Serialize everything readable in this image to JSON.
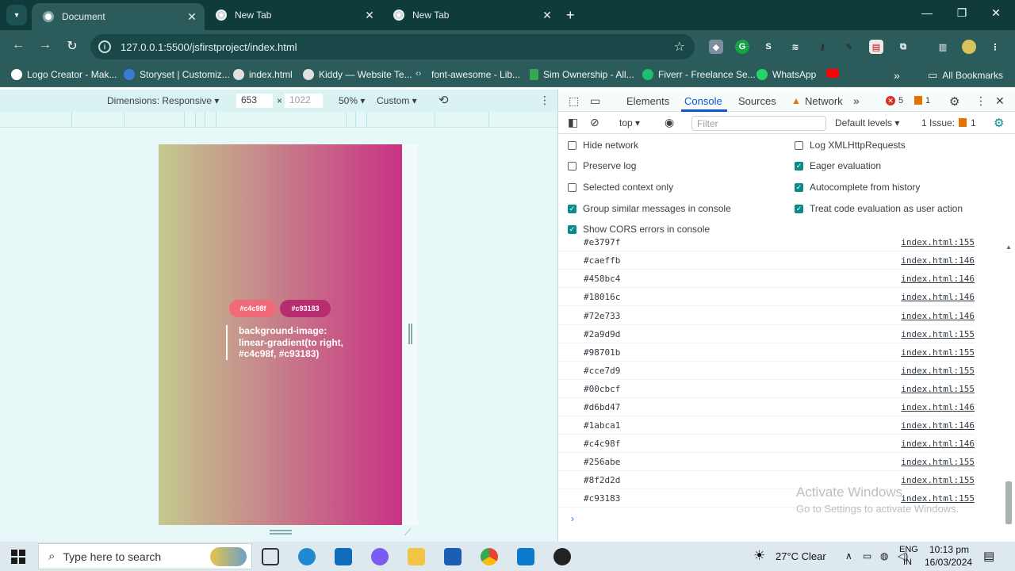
{
  "browser": {
    "tabs": [
      {
        "label": "Document"
      },
      {
        "label": "New Tab"
      },
      {
        "label": "New Tab"
      }
    ],
    "url": "127.0.0.1:5500/jsfirstproject/index.html",
    "bookmarks": [
      {
        "label": "Logo Creator - Mak...",
        "color": "#ffffff"
      },
      {
        "label": "Storyset | Customiz...",
        "color": "#3a7bd5"
      },
      {
        "label": "index.html",
        "color": "#e0e0e0"
      },
      {
        "label": "Kiddy — Website Te...",
        "color": "#e0e0e0"
      },
      {
        "label": "font-awesome - Lib...",
        "color": "#e0e0e0"
      },
      {
        "label": "Sim Ownership - All...",
        "color": "#34a853"
      },
      {
        "label": "Fiverr - Freelance Se...",
        "color": "#1dbf73"
      },
      {
        "label": "WhatsApp",
        "color": "#25d366"
      }
    ],
    "all_bookmarks": "All Bookmarks"
  },
  "device_toolbar": {
    "dimensions": "Dimensions: Responsive",
    "width": "653",
    "times": "×",
    "height": "1022",
    "zoom": "50%",
    "throttle": "Custom"
  },
  "page": {
    "chip1": "#c4c98f",
    "chip2": "#c93183",
    "code": "background-image: linear-gradient(to right, #c4c98f, #c93183)"
  },
  "devtools": {
    "tabs": [
      "Elements",
      "Console",
      "Sources",
      "Network"
    ],
    "errors": "5",
    "warnings": "1",
    "context": "top",
    "filter_placeholder": "Filter",
    "levels": "Default levels",
    "issues": "1 Issue:",
    "issues_count": "1",
    "settings_left": [
      {
        "label": "Hide network",
        "checked": false
      },
      {
        "label": "Preserve log",
        "checked": false
      },
      {
        "label": "Selected context only",
        "checked": false
      },
      {
        "label": "Group similar messages in console",
        "checked": true
      },
      {
        "label": "Show CORS errors in console",
        "checked": true
      }
    ],
    "settings_right": [
      {
        "label": "Log XMLHttpRequests",
        "checked": false
      },
      {
        "label": "Eager evaluation",
        "checked": true
      },
      {
        "label": "Autocomplete from history",
        "checked": true
      },
      {
        "label": "Treat code evaluation as user action",
        "checked": true
      }
    ],
    "logs": [
      {
        "msg": "#e3797f",
        "src": "index.html:155"
      },
      {
        "msg": "#caeffb",
        "src": "index.html:146"
      },
      {
        "msg": "#458bc4",
        "src": "index.html:146"
      },
      {
        "msg": "#18016c",
        "src": "index.html:146"
      },
      {
        "msg": "#72e733",
        "src": "index.html:146"
      },
      {
        "msg": "#2a9d9d",
        "src": "index.html:155"
      },
      {
        "msg": "#98701b",
        "src": "index.html:155"
      },
      {
        "msg": "#cce7d9",
        "src": "index.html:155"
      },
      {
        "msg": "#00cbcf",
        "src": "index.html:155"
      },
      {
        "msg": "#d6bd47",
        "src": "index.html:146"
      },
      {
        "msg": "#1abca1",
        "src": "index.html:146"
      },
      {
        "msg": "#c4c98f",
        "src": "index.html:146"
      },
      {
        "msg": "#256abe",
        "src": "index.html:155"
      },
      {
        "msg": "#8f2d2d",
        "src": "index.html:155"
      },
      {
        "msg": "#c93183",
        "src": "index.html:155"
      }
    ],
    "watermark_title": "Activate Windows",
    "watermark_sub": "Go to Settings to activate Windows."
  },
  "taskbar": {
    "search_placeholder": "Type here to search",
    "weather": "27°C  Clear",
    "lang": "ENG",
    "region": "IN",
    "time": "10:13 pm",
    "date": "16/03/2024"
  }
}
